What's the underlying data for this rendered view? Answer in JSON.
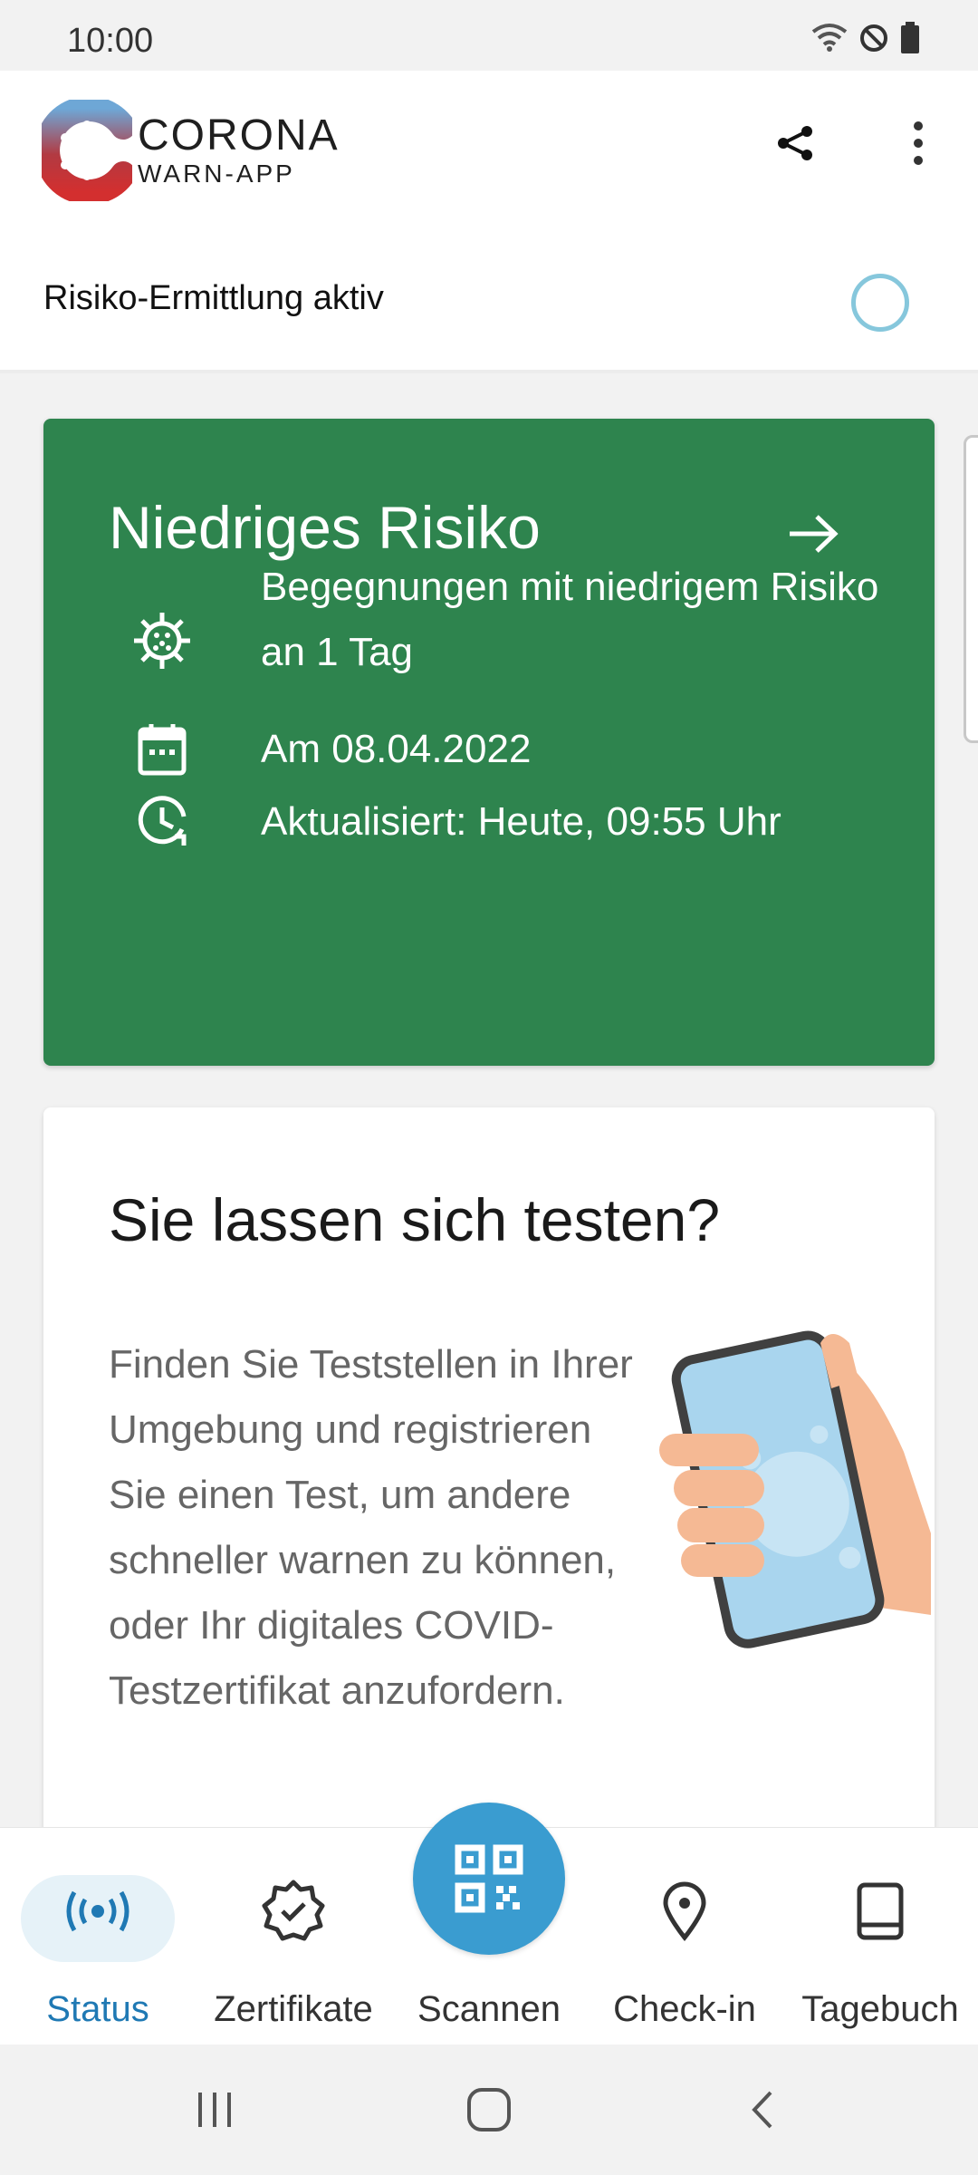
{
  "status_bar": {
    "time": "10:00"
  },
  "app": {
    "logo_title": "CORONA",
    "logo_subtitle": "WARN-APP"
  },
  "risk_detection": {
    "label": "Risiko-Ermittlung aktiv"
  },
  "risk_card": {
    "title": "Niedriges Risiko",
    "encounters": "Begegnungen mit niedrigem Risiko an 1 Tag",
    "date": "Am 08.04.2022",
    "updated": "Aktualisiert: Heute, 09:55 Uhr",
    "color": "#2e844e"
  },
  "test_card": {
    "title": "Sie lassen sich testen?",
    "text": "Finden Sie Teststellen in Ihrer Umgebung und registrieren Sie einen Test, um andere schneller warnen zu können, oder Ihr digitales COVID-Testzertifikat anzufordern."
  },
  "bottom_nav": {
    "items": [
      {
        "label": "Status",
        "icon": "broadcast-icon",
        "active": true
      },
      {
        "label": "Zertifikate",
        "icon": "certificate-badge-icon",
        "active": false
      },
      {
        "label": "Scannen",
        "icon": "qr-code-icon",
        "active": false
      },
      {
        "label": "Check-in",
        "icon": "location-pin-icon",
        "active": false
      },
      {
        "label": "Tagebuch",
        "icon": "book-icon",
        "active": false
      }
    ],
    "active_color": "#1f79b4",
    "fab_color": "#3a9cd0"
  }
}
